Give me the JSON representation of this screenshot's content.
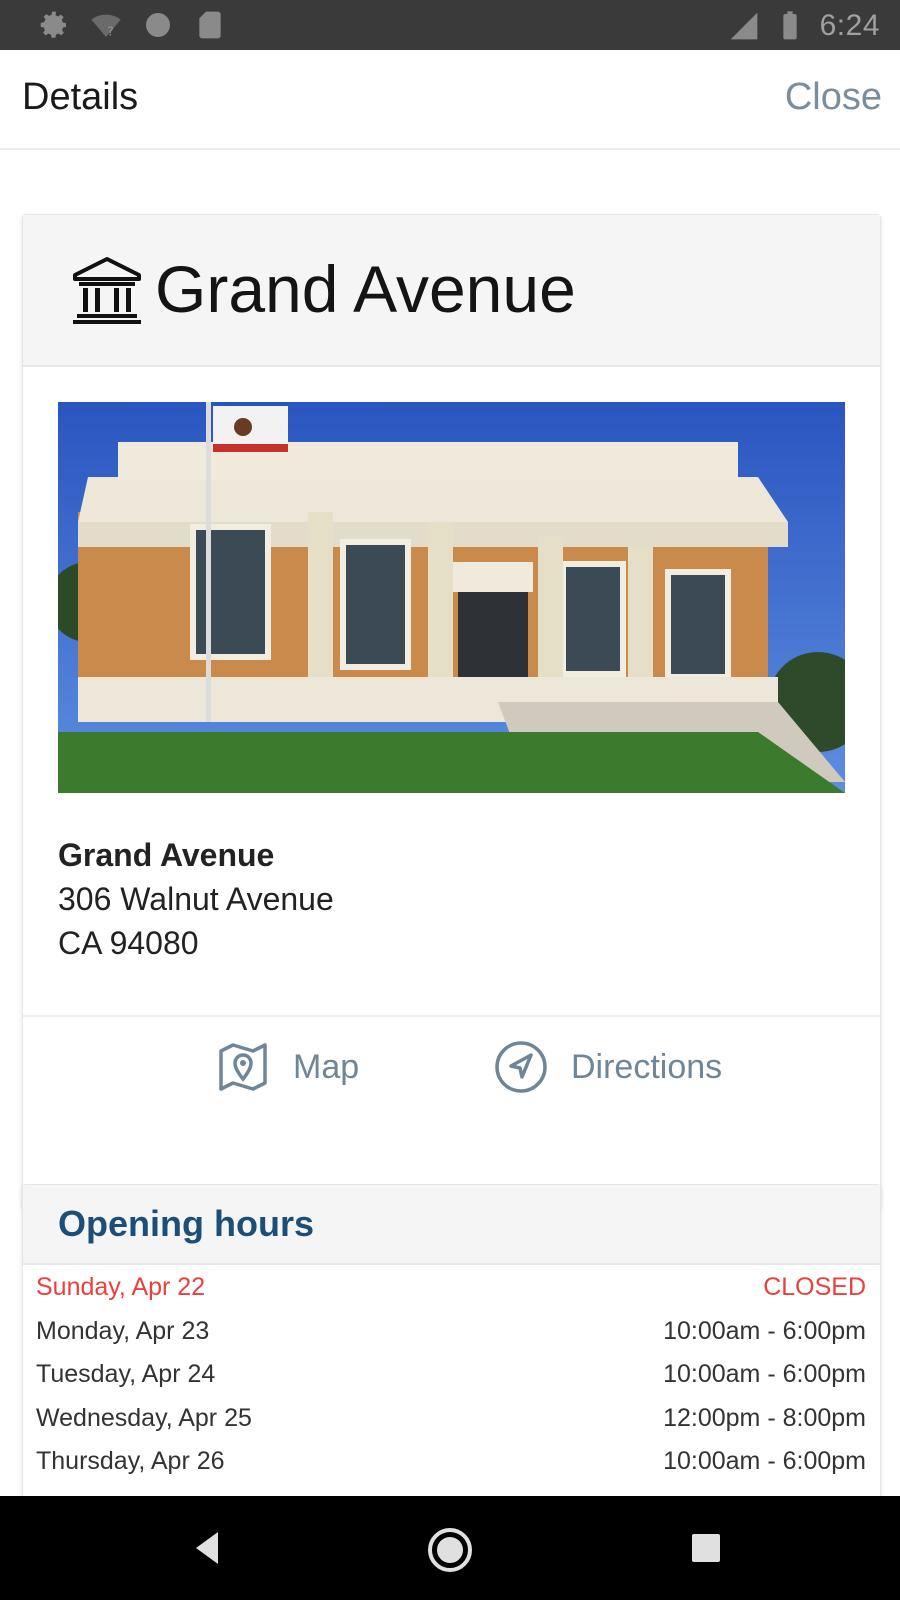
{
  "status_bar": {
    "time": "6:24",
    "left_icons": [
      "settings-icon",
      "wifi-unknown-icon",
      "circle-icon",
      "sd-card-icon"
    ],
    "right_icons": [
      "signal-icon",
      "battery-icon"
    ]
  },
  "app_bar": {
    "title": "Details",
    "close_label": "Close"
  },
  "branch": {
    "icon": "bank-building-icon",
    "name": "Grand Avenue",
    "address_name": "Grand Avenue",
    "address_line1": "306 Walnut Avenue",
    "address_line2": "CA 94080",
    "actions": {
      "map_label": "Map",
      "directions_label": "Directions"
    }
  },
  "hours": {
    "title": "Opening hours",
    "rows": [
      {
        "day": "Sunday, Apr 22",
        "time": "CLOSED",
        "closed": true
      },
      {
        "day": "Monday, Apr 23",
        "time": "10:00am - 6:00pm",
        "closed": false
      },
      {
        "day": "Tuesday, Apr 24",
        "time": "10:00am - 6:00pm",
        "closed": false
      },
      {
        "day": "Wednesday, Apr 25",
        "time": "12:00pm - 8:00pm",
        "closed": false
      },
      {
        "day": "Thursday, Apr 26",
        "time": "10:00am - 6:00pm",
        "closed": false
      }
    ]
  },
  "colors": {
    "accent": "#1c4e78",
    "action": "#6f8598",
    "closed": "#e8413c"
  }
}
